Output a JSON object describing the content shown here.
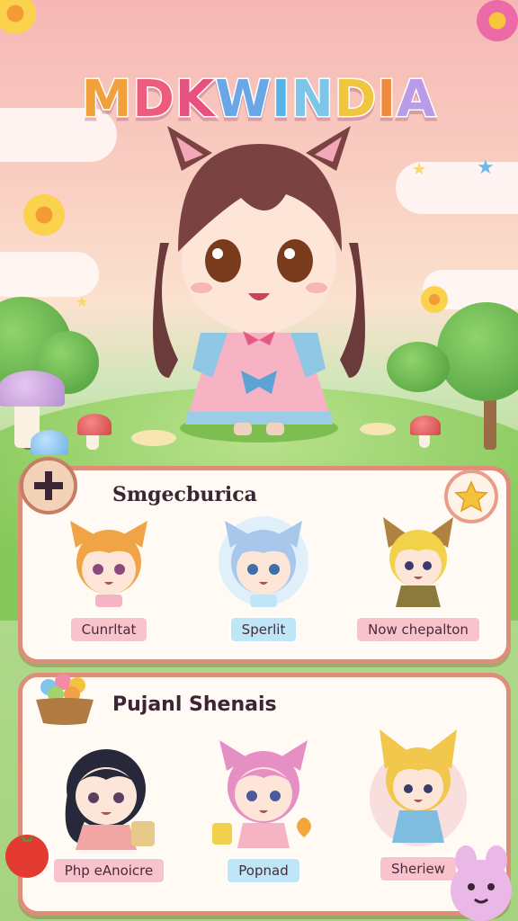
{
  "game_title": "MDKWINDIA",
  "title_letter_colors": [
    "#f0a13b",
    "#ee5b7c",
    "#e7517f",
    "#6aa7e6",
    "#59b3e8",
    "#7dc6ea",
    "#f0c641",
    "#f08a3c",
    "#b99be8"
  ],
  "panel_1": {
    "title": "Smgecburica",
    "cards": [
      {
        "name": "orange-hair-cat-girl",
        "label": "Cunrltat",
        "label_style": "pink"
      },
      {
        "name": "blue-hair-cat-girl",
        "label": "Sperlit",
        "label_style": "blue"
      },
      {
        "name": "fox-girl",
        "label": "Now chepalton",
        "label_style": "pink"
      }
    ]
  },
  "panel_2": {
    "title": "Pujanl Shenais",
    "cards": [
      {
        "name": "black-hair-girl",
        "label": "Php eAnoicre",
        "label_style": "pink"
      },
      {
        "name": "pink-cat-girl",
        "label": "Popnad",
        "label_style": "blue"
      },
      {
        "name": "blonde-fox-girl",
        "label": "Sheriew",
        "label_style": "pink"
      }
    ]
  },
  "icons": {
    "badge_left": "cross-icon",
    "badge_right": "star-icon",
    "panel_2_icon": "candy-basket-icon"
  },
  "colors": {
    "panel_border": "#de8e78",
    "panel_bg": "#fffaf4",
    "tag_pink": "#f9c3cb",
    "tag_blue": "#bfe6f6"
  }
}
